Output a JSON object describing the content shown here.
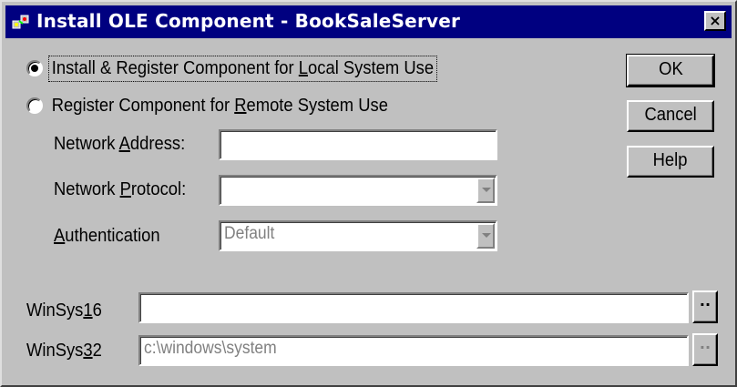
{
  "window": {
    "title": "Install OLE Component - BookSaleServer",
    "close_glyph": "×",
    "app_icon": "ole-component-icon"
  },
  "options": {
    "local": {
      "pre": "Install & Register Component for ",
      "accel": "L",
      "post": "ocal System Use",
      "checked": true
    },
    "remote": {
      "pre": "Register Component for ",
      "accel": "R",
      "post": "emote System Use",
      "checked": false
    }
  },
  "network": {
    "address_label": {
      "pre": "Network ",
      "accel": "A",
      "post": "ddress:"
    },
    "address_value": "",
    "protocol_label": {
      "pre": "Network ",
      "accel": "P",
      "post": "rotocol:"
    },
    "protocol_value": "",
    "auth_label": {
      "pre": "",
      "accel": "A",
      "post": "uthentication"
    },
    "auth_value": "Default"
  },
  "paths": {
    "win16_label": {
      "pre": "WinSys",
      "accel": "1",
      "post": "6"
    },
    "win16_value": "",
    "win32_label": {
      "pre": "WinSys",
      "accel": "3",
      "post": "2"
    },
    "win32_value": "c:\\windows\\system",
    "browse_label": "··"
  },
  "buttons": {
    "ok": "OK",
    "cancel": "Cancel",
    "help": "Help"
  }
}
